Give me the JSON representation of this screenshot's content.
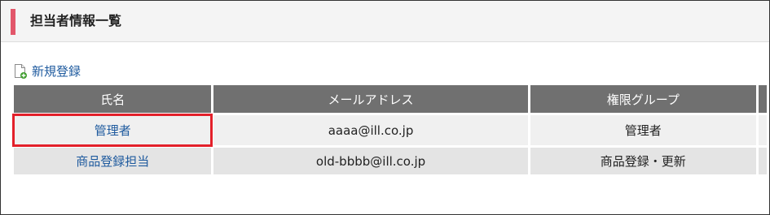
{
  "header": {
    "title": "担当者情報一覧"
  },
  "actions": {
    "new_label": "新規登録"
  },
  "table": {
    "columns": [
      "氏名",
      "メールアドレス",
      "権限グループ"
    ],
    "rows": [
      {
        "name": "管理者",
        "email": "aaaa@ill.co.jp",
        "group": "管理者"
      },
      {
        "name": "商品登録担当",
        "email": "old-bbbb@ill.co.jp",
        "group": "商品登録・更新"
      }
    ]
  },
  "colors": {
    "accent": "#e2566a",
    "header_bg": "#707070",
    "link": "#1e5a9e",
    "highlight": "#e3202a"
  },
  "icons": {
    "new": "document-add-icon"
  }
}
